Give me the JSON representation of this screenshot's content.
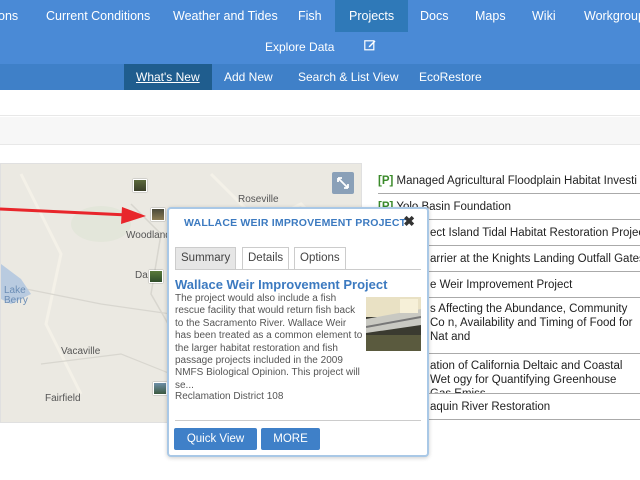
{
  "topnav": {
    "items": [
      {
        "label": "ons"
      },
      {
        "label": "Current Conditions"
      },
      {
        "label": "Weather and Tides"
      },
      {
        "label": "Fish"
      },
      {
        "label": "Projects"
      },
      {
        "label": "Docs"
      },
      {
        "label": "Maps"
      },
      {
        "label": "Wiki"
      },
      {
        "label": "Workgroup"
      }
    ],
    "active_index": 4,
    "explore_label": "Explore Data",
    "color": "#4a8ad6"
  },
  "subnav": {
    "items": [
      {
        "label": "What's New"
      },
      {
        "label": "Add New"
      },
      {
        "label": "Search & List View"
      },
      {
        "label": "EcoRestore"
      }
    ],
    "active_index": 0
  },
  "map": {
    "labels": [
      "Roseville",
      "Woodland",
      "Da",
      "Lake",
      "Berry",
      "Vacaville",
      "Fairfield"
    ]
  },
  "project_list": [
    {
      "tag": "[P]",
      "text": " Managed Agricultural Floodplain Habitat Investi"
    },
    {
      "tag": "[P]",
      "text": " Yolo Basin Foundation"
    },
    {
      "tag": "",
      "text": "ect Island Tidal Habitat Restoration Projec"
    },
    {
      "tag": "",
      "text": "arrier at the Knights Landing Outfall Gates"
    },
    {
      "tag": "",
      "text": "e Weir Improvement Project"
    },
    {
      "tag": "",
      "text": "s Affecting the Abundance, Community Co n, Availability and Timing of Food for Nat and"
    },
    {
      "tag": "",
      "text": "ation of California Deltaic and Coastal Wet ogy for Quantifying Greenhouse Gas Emiss"
    },
    {
      "tag": "",
      "text": "aquin River Restoration"
    }
  ],
  "popup": {
    "title": "WALLACE WEIR IMPROVEMENT PROJECT",
    "close": "✖",
    "tabs": [
      "Summary",
      "Details",
      "Options"
    ],
    "active_tab": 0,
    "project_name": "Wallace Weir Improvement Project",
    "description": "The project would also include a fish rescue facility that would return fish back to the Sacramento River. Wallace Weir has been treated as a common element to the larger habitat restoration and fish passage projects included in the 2009 NMFS Biological Opinion. This project will se...",
    "owner": "Reclamation District 108",
    "quick_view_label": "Quick View",
    "more_label": "MORE"
  }
}
